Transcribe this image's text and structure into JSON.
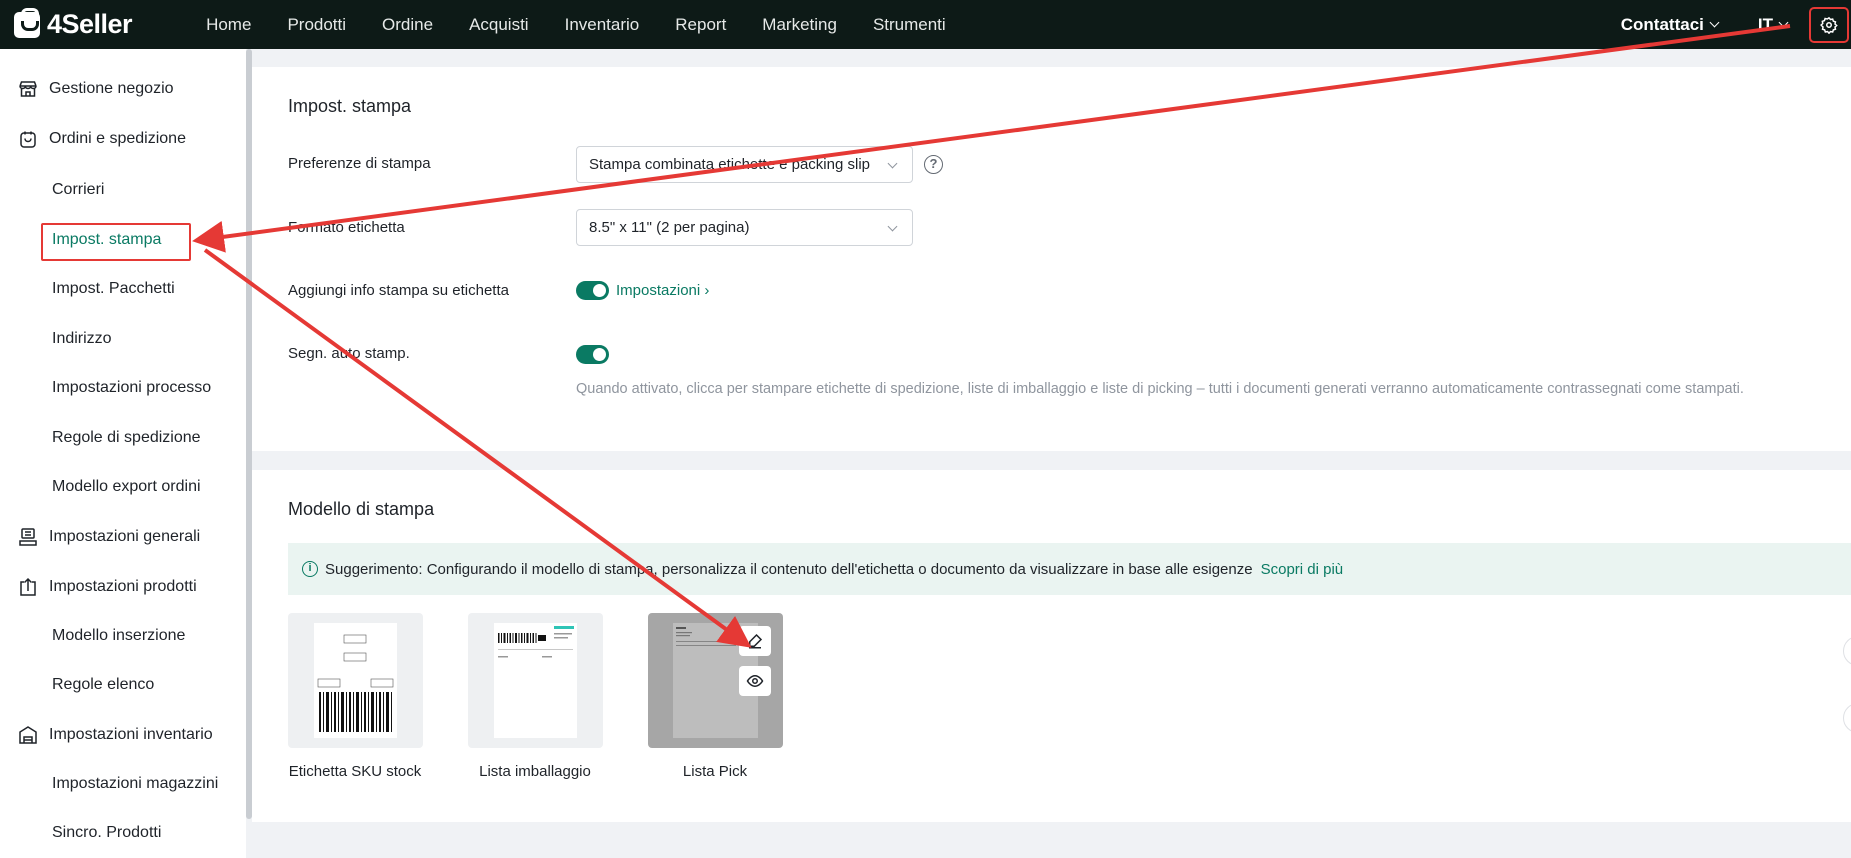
{
  "brand": {
    "name": "4Seller"
  },
  "nav": {
    "items": [
      {
        "label": "Home"
      },
      {
        "label": "Prodotti"
      },
      {
        "label": "Ordine"
      },
      {
        "label": "Acquisti"
      },
      {
        "label": "Inventario"
      },
      {
        "label": "Report"
      },
      {
        "label": "Marketing"
      },
      {
        "label": "Strumenti"
      }
    ],
    "contact": "Contattaci",
    "language": "IT"
  },
  "sidebar": {
    "groups": [
      {
        "label": "Gestione negozio",
        "icon": "store-icon"
      },
      {
        "label": "Ordini e spedizione",
        "icon": "bag-icon"
      },
      {
        "label": "Impostazioni generali",
        "icon": "printer-icon"
      },
      {
        "label": "Impostazioni prodotti",
        "icon": "upload-box-icon"
      },
      {
        "label": "Impostazioni inventario",
        "icon": "warehouse-icon"
      }
    ],
    "items": [
      {
        "label": "Corrieri"
      },
      {
        "label": "Impost. stampa"
      },
      {
        "label": "Impost. Pacchetti"
      },
      {
        "label": "Indirizzo"
      },
      {
        "label": "Impostazioni processo"
      },
      {
        "label": "Regole di spedizione"
      },
      {
        "label": "Modello export ordini"
      },
      {
        "label": "Modello inserzione"
      },
      {
        "label": "Regole elenco"
      },
      {
        "label": "Impostazioni magazzini"
      },
      {
        "label": "Sincro. Prodotti"
      }
    ],
    "active": "Impost. stampa"
  },
  "print_settings": {
    "title": "Impost. stampa",
    "preferences_label": "Preferenze di stampa",
    "preferences_value": "Stampa combinata etichette e packing slip",
    "format_label": "Formato etichetta",
    "format_value": "8.5\" x 11\" (2 per pagina)",
    "add_info_label": "Aggiungi info stampa su etichetta",
    "add_info_enabled": true,
    "settings_link": "Impostazioni",
    "auto_mark_label": "Segn. auto stamp.",
    "auto_mark_enabled": true,
    "auto_mark_hint": "Quando attivato, clicca per stampare etichette di spedizione, liste di imballaggio e liste di picking – tutti i documenti generati verranno automaticamente contrassegnati come stampati."
  },
  "print_templates": {
    "title": "Modello di stampa",
    "tip": "Suggerimento: Configurando il modello di stampa, personalizza il contenuto dell'etichetta o documento da visualizzare in base alle esigenze",
    "tip_link": "Scopri di più",
    "templates": [
      {
        "label": "Etichetta SKU stock"
      },
      {
        "label": "Lista imballaggio"
      },
      {
        "label": "Lista Pick"
      }
    ]
  },
  "colors": {
    "accent": "#0a7a63",
    "topbar": "#0d1a17",
    "annotation": "#e53935"
  }
}
